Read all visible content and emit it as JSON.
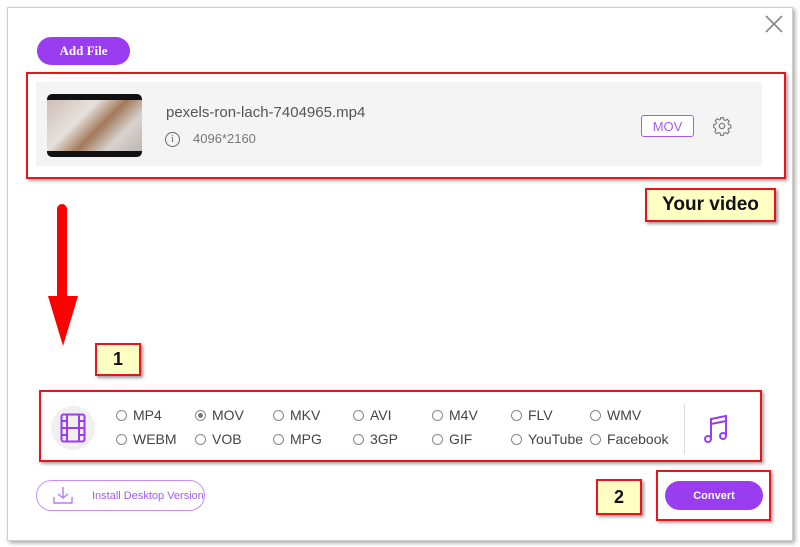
{
  "header": {
    "add_file_label": "Add File",
    "close_icon": "close-icon"
  },
  "video": {
    "filename": "pexels-ron-lach-7404965.mp4",
    "resolution": "4096*2160",
    "format_badge": "MOV",
    "info_icon_glyph": "i"
  },
  "annotations": {
    "your_video": "Your video",
    "step1": "1",
    "step2": "2",
    "highlight_color": "#e8141b",
    "note_bg": "#ffffc4"
  },
  "formats": {
    "options": [
      {
        "label": "MP4",
        "selected": false
      },
      {
        "label": "MOV",
        "selected": true
      },
      {
        "label": "MKV",
        "selected": false
      },
      {
        "label": "AVI",
        "selected": false
      },
      {
        "label": "M4V",
        "selected": false
      },
      {
        "label": "FLV",
        "selected": false
      },
      {
        "label": "WMV",
        "selected": false
      },
      {
        "label": "WEBM",
        "selected": false
      },
      {
        "label": "VOB",
        "selected": false
      },
      {
        "label": "MPG",
        "selected": false
      },
      {
        "label": "3GP",
        "selected": false
      },
      {
        "label": "GIF",
        "selected": false
      },
      {
        "label": "YouTube",
        "selected": false
      },
      {
        "label": "Facebook",
        "selected": false
      }
    ]
  },
  "footer": {
    "install_label": "Install Desktop Version",
    "convert_label": "Convert"
  },
  "colors": {
    "accent": "#9a3cf0"
  }
}
